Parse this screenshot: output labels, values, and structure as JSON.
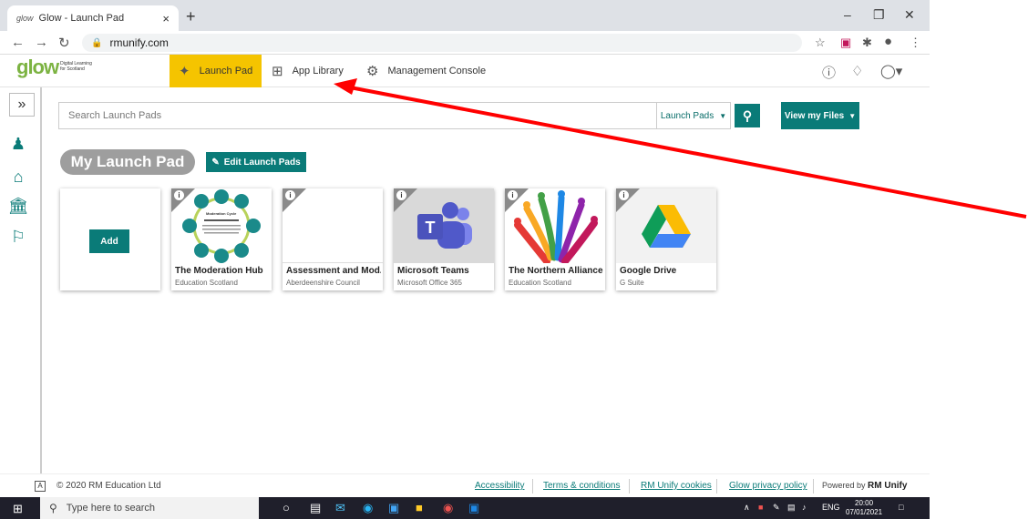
{
  "browser": {
    "tab_favicon": "glow",
    "tab_title": "Glow - Launch Pad",
    "tab_close": "×",
    "new_tab": "+",
    "url": "rmunify.com"
  },
  "header": {
    "logo_text": "glow",
    "logo_tagline": "Digital Learning for Scotland",
    "nav": [
      {
        "label": "Launch Pad",
        "icon": "rocket-icon",
        "active": true
      },
      {
        "label": "App Library",
        "icon": "grid-icon",
        "active": false
      },
      {
        "label": "Management Console",
        "icon": "gear-icon",
        "active": false
      }
    ]
  },
  "search": {
    "placeholder": "Search Launch Pads",
    "scope_label": "Launch Pads",
    "view_files_label": "View my Files"
  },
  "launchpad": {
    "title": "My Launch Pad",
    "edit_label": "Edit Launch Pads",
    "add_label": "Add",
    "tiles": [
      {
        "name": "The Moderation Hub",
        "provider": "Education Scotland"
      },
      {
        "name": "Assessment and Mod...",
        "provider": "Aberdeenshire Council"
      },
      {
        "name": "Microsoft Teams",
        "provider": "Microsoft Office 365"
      },
      {
        "name": "The Northern Alliance",
        "provider": "Education Scotland"
      },
      {
        "name": "Google Drive",
        "provider": "G Suite"
      }
    ],
    "moderation_thumb_title": "Moderation Cycle"
  },
  "footer": {
    "copyright": "© 2020 RM Education Ltd",
    "links": [
      "Accessibility",
      "Terms & conditions",
      "RM Unify cookies",
      "Glow privacy policy"
    ],
    "powered_prefix": "Powered by",
    "powered_brand": "RM Unify"
  },
  "taskbar": {
    "search_placeholder": "Type here to search",
    "language": "ENG",
    "time": "20:00",
    "date": "07/01/2021"
  },
  "colors": {
    "teal": "#0a7b78",
    "launchpad_active": "#f5c400",
    "annotation_arrow": "#ff0000"
  }
}
